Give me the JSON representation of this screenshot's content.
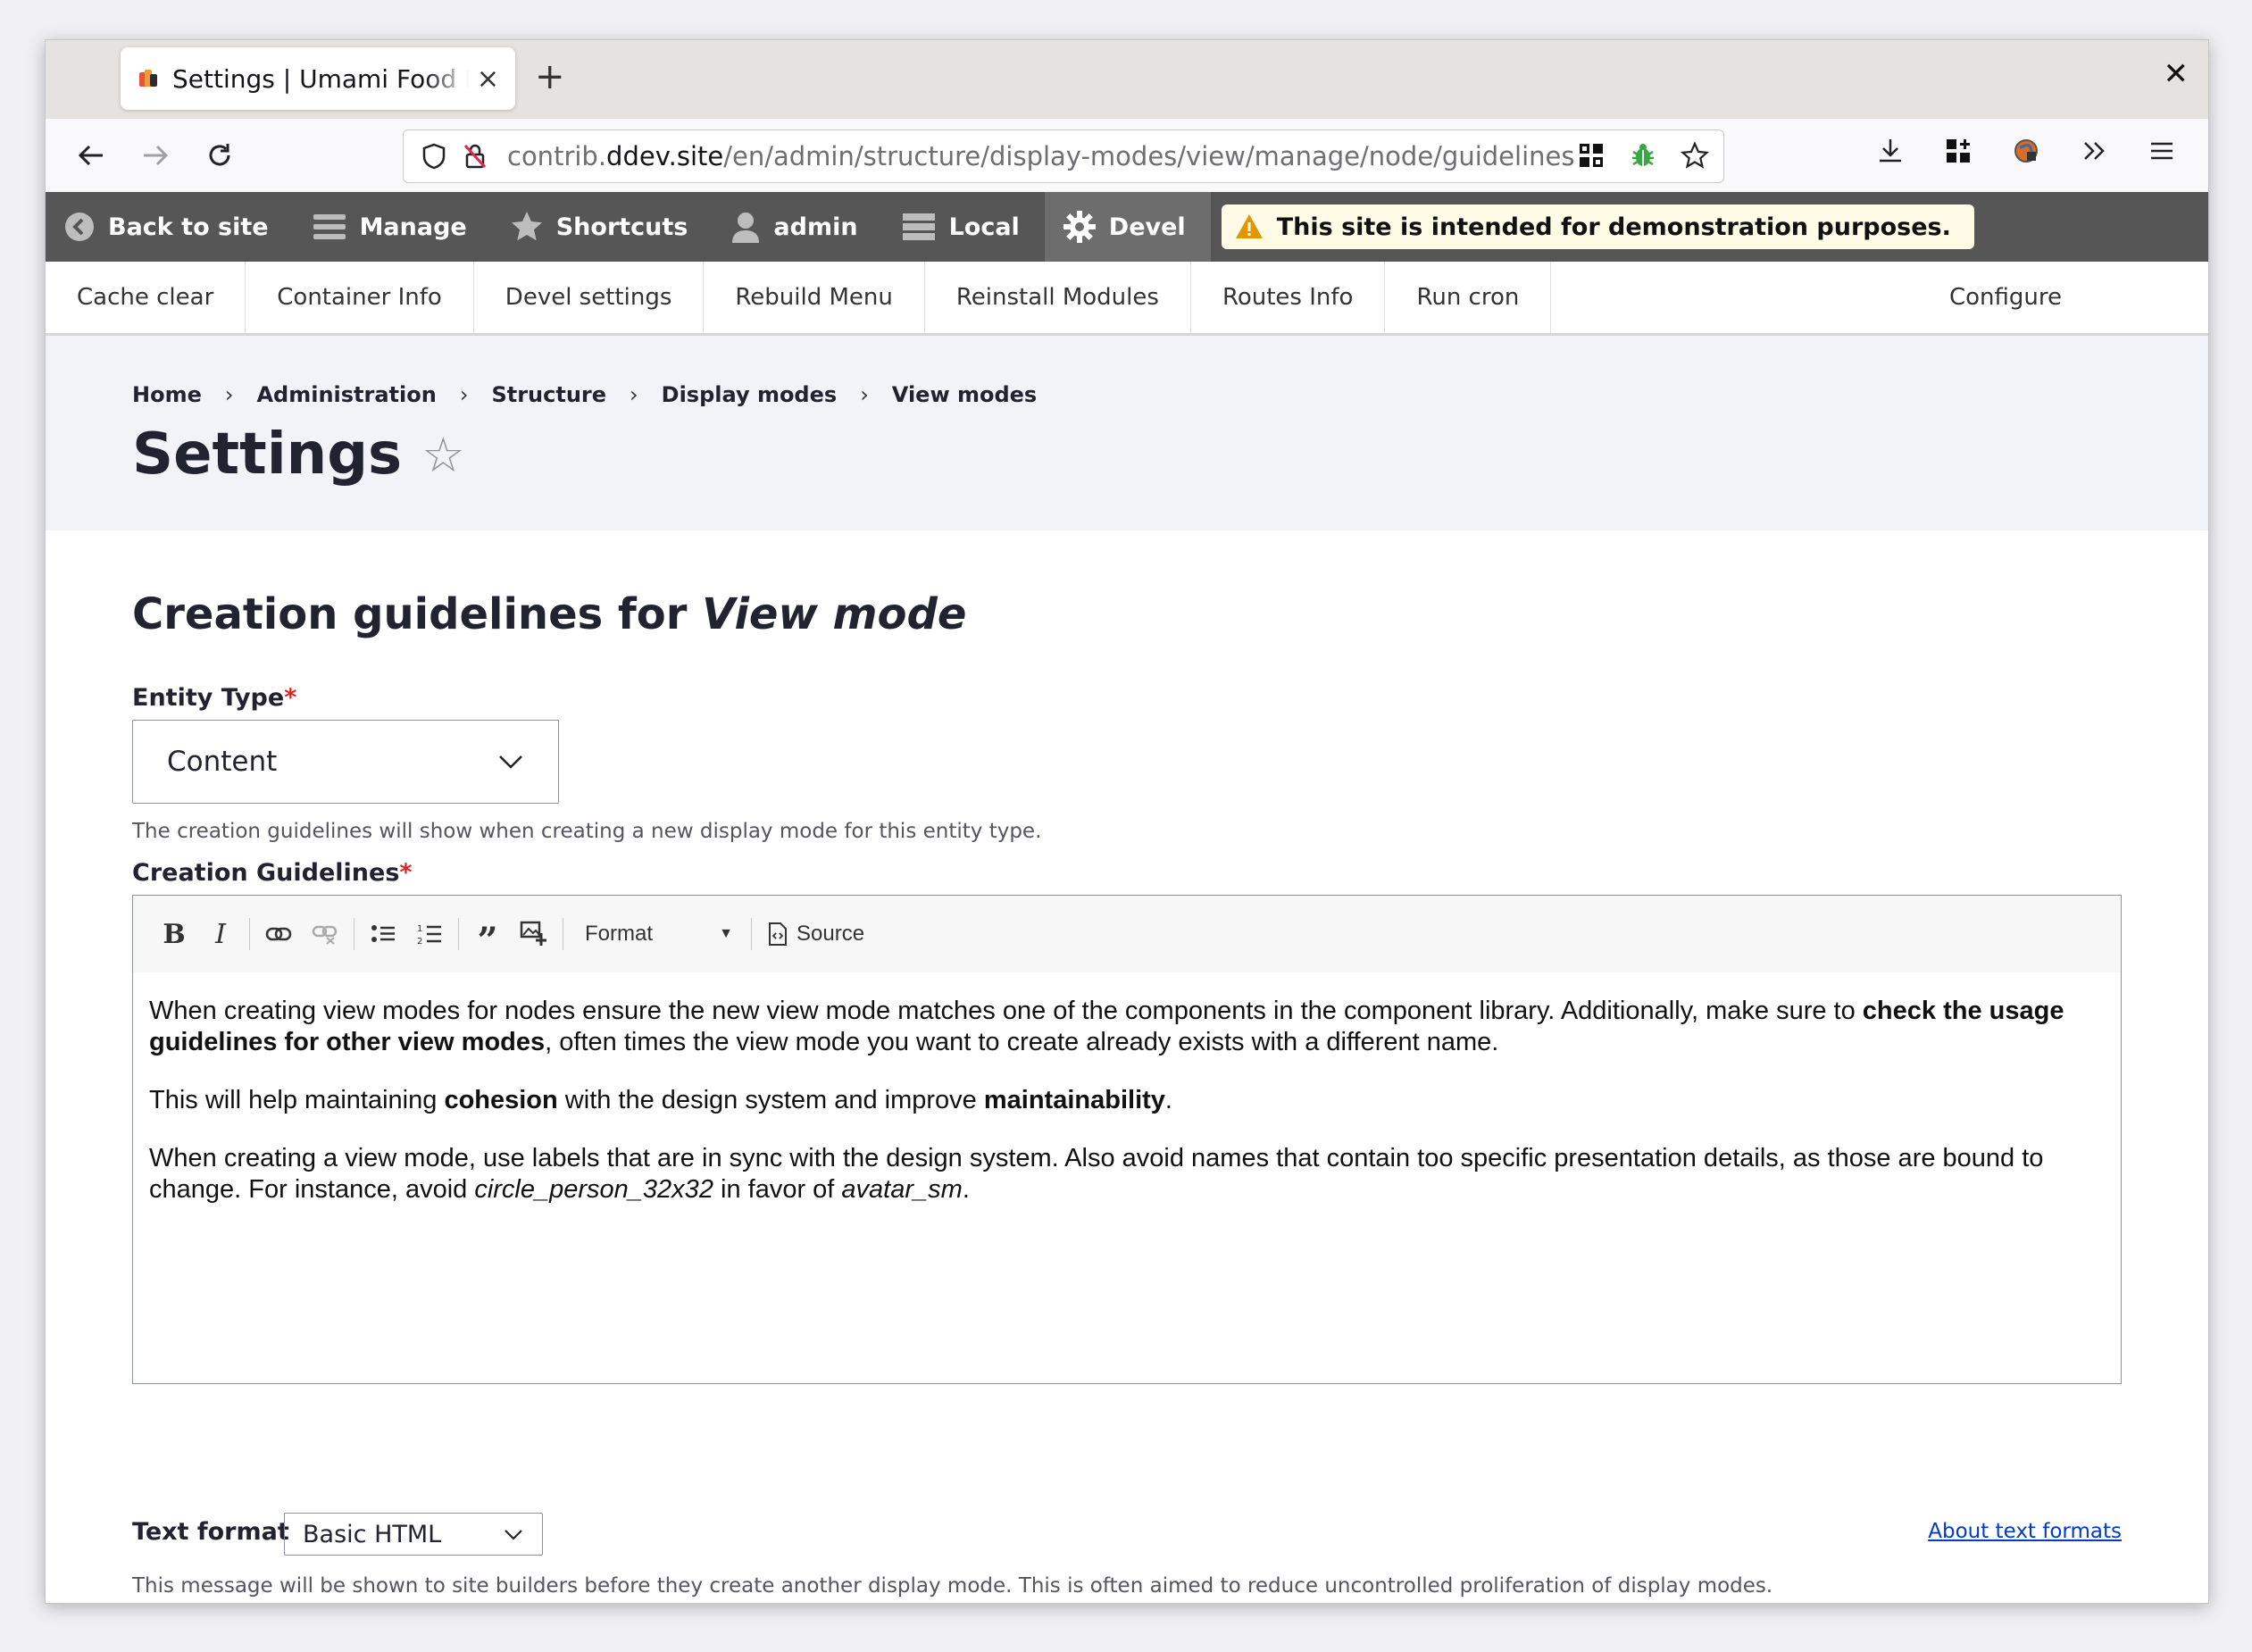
{
  "browser": {
    "tab_title": "Settings | Umami Food Magazine",
    "url_prefix": "contrib.",
    "url_host": "ddev.site",
    "url_path": "/en/admin/structure/display-modes/view/manage/node/guidelines"
  },
  "toolbar": {
    "back": "Back to site",
    "manage": "Manage",
    "shortcuts": "Shortcuts",
    "user": "admin",
    "local": "Local",
    "devel": "Devel",
    "warning": "This site is intended for demonstration purposes."
  },
  "devel_tray": [
    "Cache clear",
    "Container Info",
    "Devel settings",
    "Rebuild Menu",
    "Reinstall Modules",
    "Routes Info",
    "Run cron",
    "Configure"
  ],
  "breadcrumb": [
    "Home",
    "Administration",
    "Structure",
    "Display modes",
    "View modes"
  ],
  "page_title": "Settings",
  "form": {
    "heading_prefix": "Creation guidelines for ",
    "heading_em": "View mode",
    "entity_type_label": "Entity Type",
    "required_mark": "*",
    "entity_type_value": "Content",
    "entity_type_desc": "The creation guidelines will show when creating a new display mode for this entity type.",
    "guidelines_label": "Creation Guidelines",
    "editor_format": "Format",
    "editor_source": "Source",
    "body": {
      "p1_a": "When creating view modes for nodes ensure the new view mode matches one of the components in the component library. Additionally, make sure to ",
      "p1_b": "check the usage guidelines for other view modes",
      "p1_c": ", often times the view mode you want to create already exists with a different name.",
      "p2_a": "This will help maintaining ",
      "p2_b": "cohesion",
      "p2_c": " with the design system and improve ",
      "p2_d": "maintainability",
      "p2_e": ".",
      "p3_a": "When creating a view mode, use labels that are in sync with the design system. Also avoid names that contain too specific presentation details, as those are bound to change. For instance, avoid ",
      "p3_b": "circle_person_32x32",
      "p3_c": " in favor of ",
      "p3_d": "avatar_sm",
      "p3_e": "."
    },
    "text_format_label": "Text format",
    "text_format_value": "Basic HTML",
    "about_link": "About text formats",
    "guidelines_desc": "This message will be shown to site builders before they create another display mode. This is often aimed to reduce uncontrolled proliferation of display modes."
  }
}
